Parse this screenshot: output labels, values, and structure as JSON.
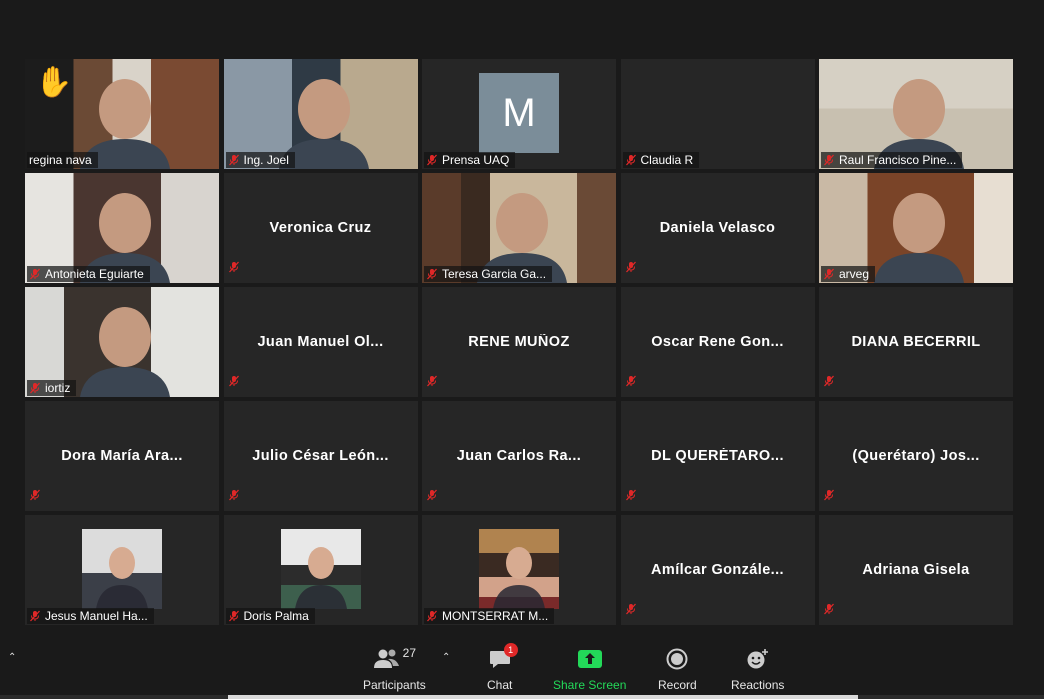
{
  "tiles": [
    {
      "name": "regina nava",
      "type": "video",
      "active": true,
      "raised_hand": true
    },
    {
      "name": "Ing. Joel",
      "type": "video"
    },
    {
      "name": "Prensa UAQ",
      "type": "letter",
      "letter": "M"
    },
    {
      "name": "Claudia R",
      "type": "blank"
    },
    {
      "name": "Raul Francisco Pine...",
      "type": "video"
    },
    {
      "name": "Antonieta Eguiarte",
      "type": "video"
    },
    {
      "name": "Veronica Cruz",
      "type": "name"
    },
    {
      "name": "Teresa Garcia Ga...",
      "type": "video"
    },
    {
      "name": "Daniela Velasco",
      "type": "name"
    },
    {
      "name": "arveg",
      "type": "video"
    },
    {
      "name": "iortiz",
      "type": "video"
    },
    {
      "name": "Juan Manuel Ol...",
      "type": "name"
    },
    {
      "name": "RENE MUÑOZ",
      "type": "name"
    },
    {
      "name": "Oscar Rene Gon...",
      "type": "name"
    },
    {
      "name": "DIANA BECERRIL",
      "type": "name"
    },
    {
      "name": "Dora María Ara...",
      "type": "name"
    },
    {
      "name": "Julio César León...",
      "type": "name"
    },
    {
      "name": "Juan Carlos Ra...",
      "type": "name"
    },
    {
      "name": "DL QUERÉTARO...",
      "type": "name"
    },
    {
      "name": "(Querétaro) Jos...",
      "type": "name"
    },
    {
      "name": "Jesus Manuel Ha...",
      "type": "photo"
    },
    {
      "name": "Doris Palma",
      "type": "photo"
    },
    {
      "name": "MONTSERRAT M...",
      "type": "photo"
    },
    {
      "name": "Amílcar Gonzále...",
      "type": "name"
    },
    {
      "name": "Adriana Gisela",
      "type": "name"
    }
  ],
  "toolbar": {
    "participants_label": "Participants",
    "participants_count": "27",
    "chat_label": "Chat",
    "chat_badge": "1",
    "share_label": "Share Screen",
    "record_label": "Record",
    "reactions_label": "Reactions"
  },
  "colors": {
    "active_border": "#dce775",
    "share_green": "#23d959",
    "mute_red": "#e02828",
    "tile_bg": "#262626"
  }
}
